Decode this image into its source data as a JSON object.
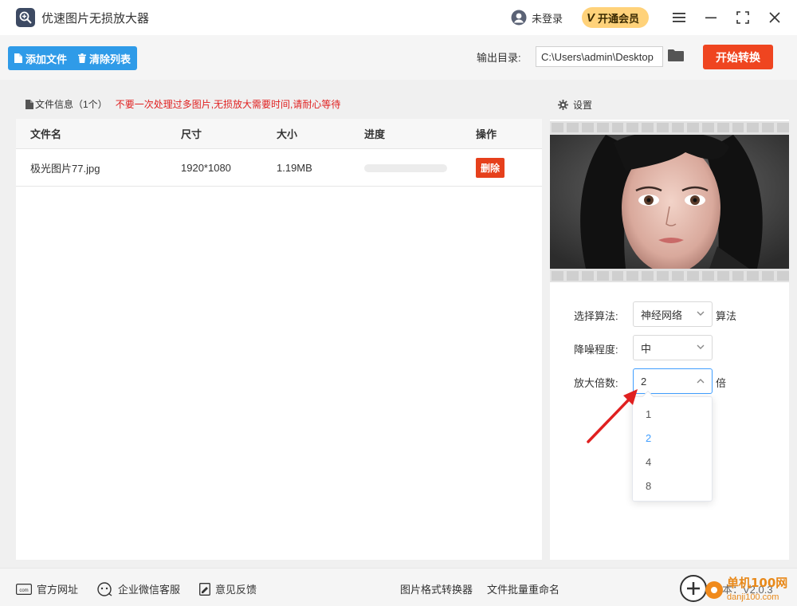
{
  "app": {
    "title": "优速图片无损放大器"
  },
  "header": {
    "login_label": "未登录",
    "vip_label": "开通会员",
    "vip_badge": "V"
  },
  "toolbar": {
    "add_file_label": "添加文件",
    "clear_list_label": "清除列表",
    "output_dir_label": "输出目录:",
    "output_dir_value": "C:\\Users\\admin\\Desktop",
    "start_label": "开始转换"
  },
  "file_panel": {
    "title": "文件信息（1个）",
    "warning": "不要一次处理过多图片,无损放大需要时间,请耐心等待",
    "columns": [
      "文件名",
      "尺寸",
      "大小",
      "进度",
      "操作"
    ],
    "rows": [
      {
        "name": "极光图片77.jpg",
        "size": "1920*1080",
        "filesize": "1.19MB",
        "progress": 0,
        "action": "删除"
      }
    ]
  },
  "settings": {
    "title": "设置",
    "algorithm_label": "选择算法:",
    "algorithm_value": "神经网络",
    "algorithm_suffix": "算法",
    "denoise_label": "降噪程度:",
    "denoise_value": "中",
    "scale_label": "放大倍数:",
    "scale_value": "2",
    "scale_suffix": "倍",
    "scale_options": [
      "1",
      "2",
      "4",
      "8"
    ],
    "scale_selected_index": 1
  },
  "footer": {
    "website_label": "官方网址",
    "wechat_label": "企业微信客服",
    "feedback_label": "意见反馈",
    "format_converter_label": "图片格式转换器",
    "batch_rename_label": "文件批量重命名",
    "version_label": "本：V2.0.3"
  },
  "watermark": {
    "site_name": "单机100网",
    "site_url": "danji100.com"
  },
  "colors": {
    "primary": "#2f9be8",
    "danger": "#ef4520",
    "accent": "#409eff",
    "warning_text": "#e02020",
    "annotation_arrow": "#e02020"
  }
}
